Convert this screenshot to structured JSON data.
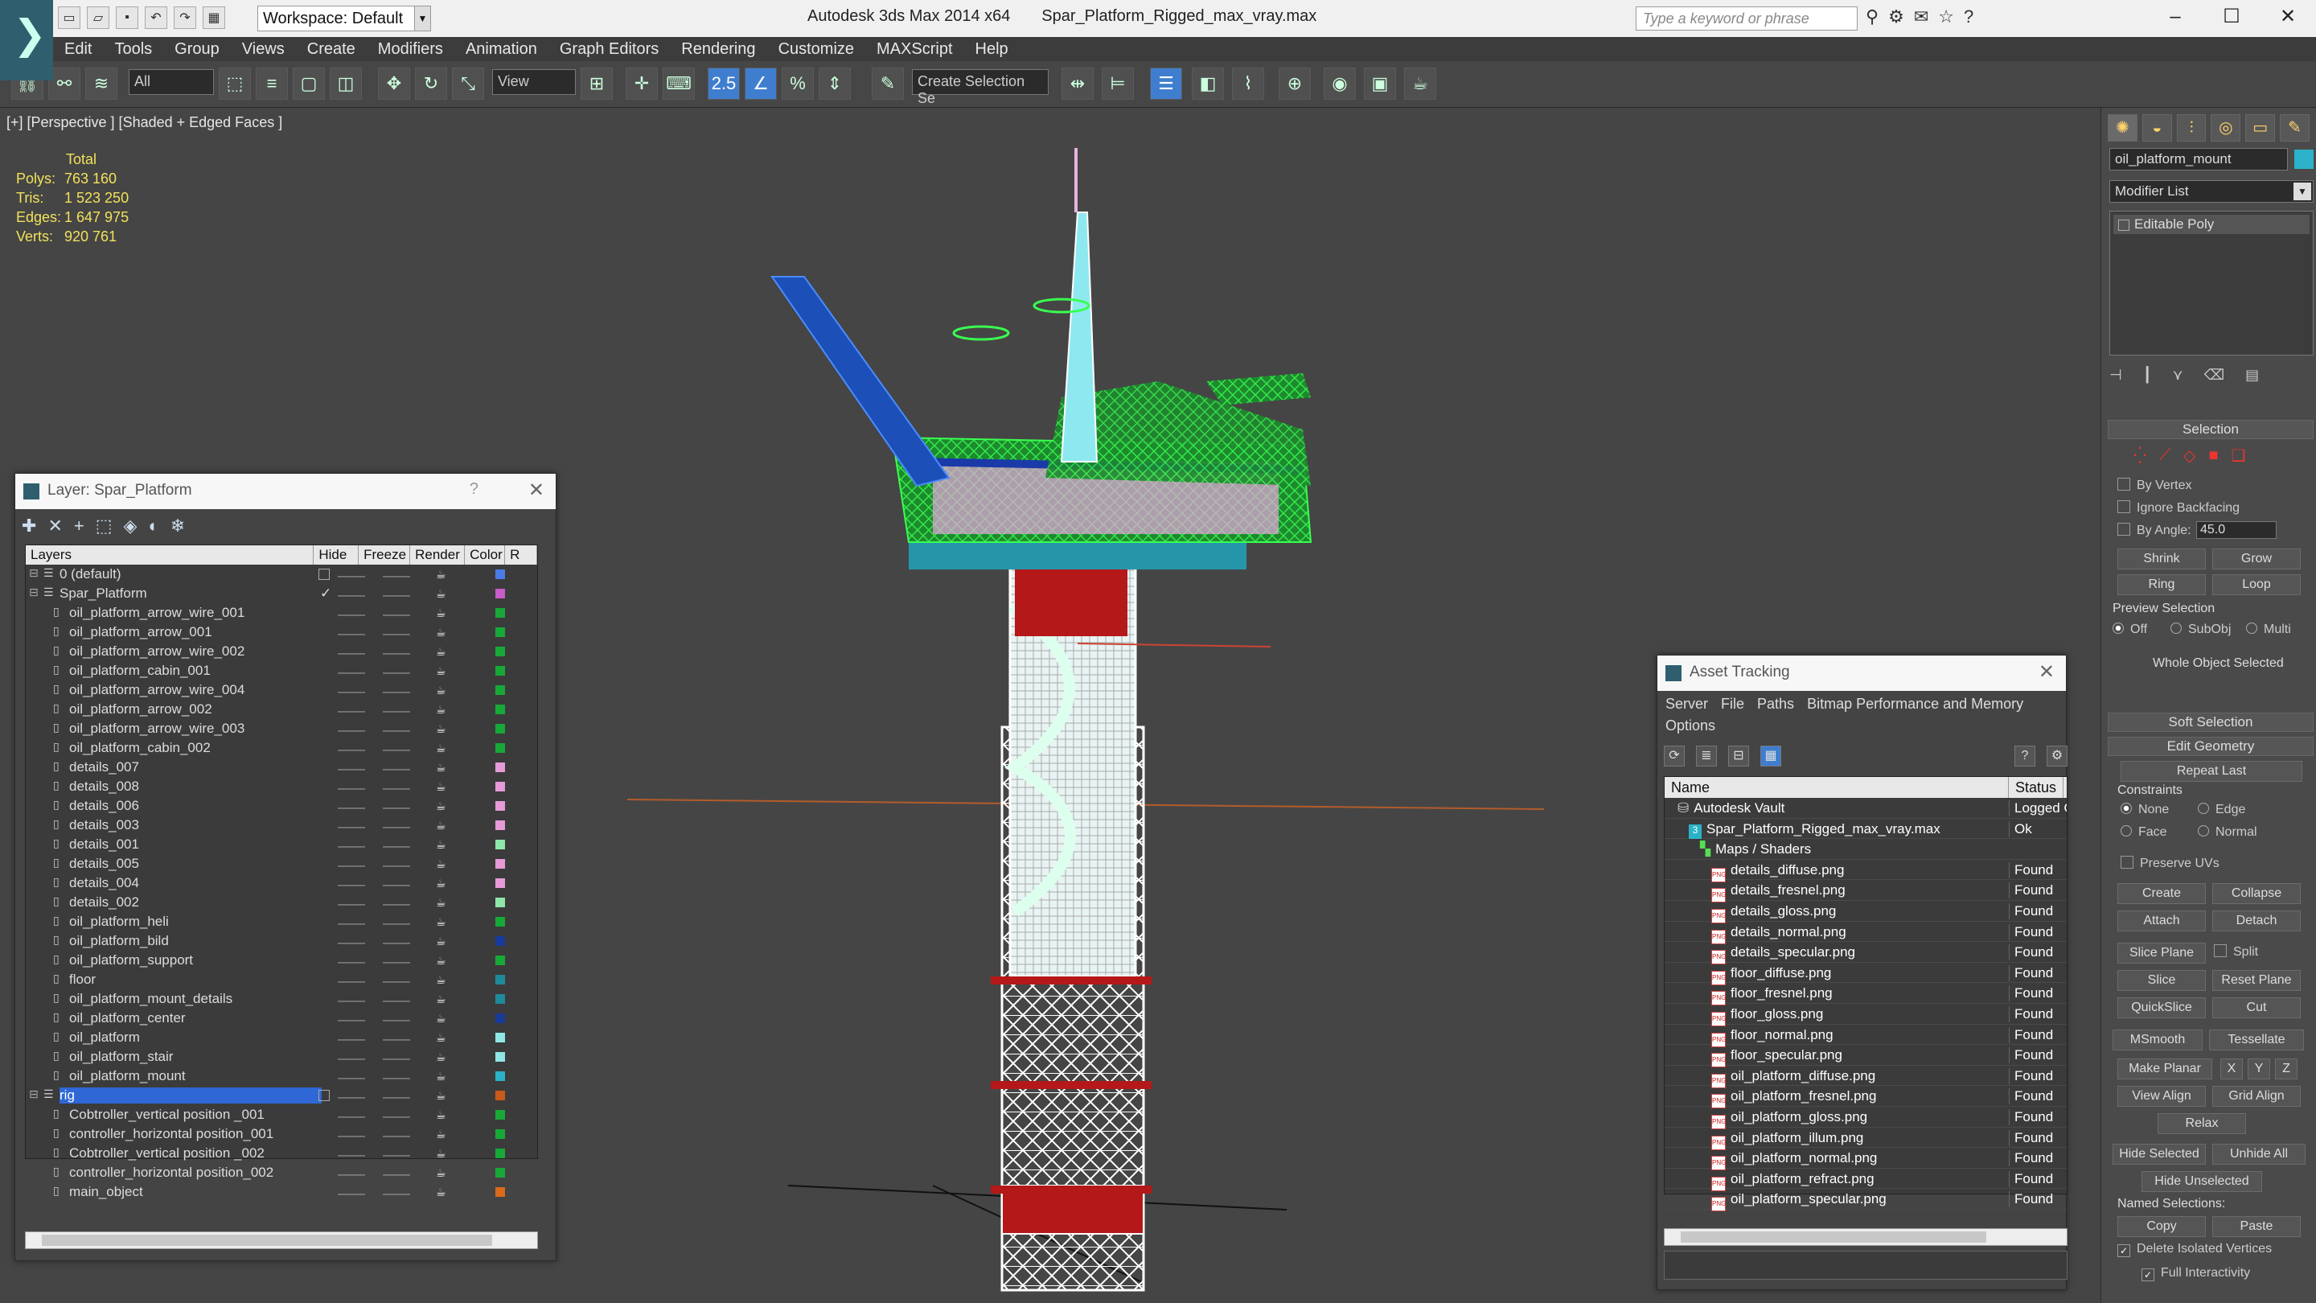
{
  "app": {
    "title": "Autodesk 3ds Max 2014 x64",
    "file": "Spar_Platform_Rigged_max_vray.max",
    "workspace": "Workspace: Default",
    "search_placeholder": "Type a keyword or phrase"
  },
  "menu": [
    "Edit",
    "Tools",
    "Group",
    "Views",
    "Create",
    "Modifiers",
    "Animation",
    "Graph Editors",
    "Rendering",
    "Customize",
    "MAXScript",
    "Help"
  ],
  "toolbar": {
    "filter": "All",
    "view": "View",
    "selection_set": "Create Selection Se",
    "snap": "2.5"
  },
  "viewport": {
    "label": "[+] [Perspective ] [Shaded + Edged Faces ]",
    "stats_header": "Total",
    "stats": [
      {
        "k": "Polys:",
        "v": "763 160"
      },
      {
        "k": "Tris:",
        "v": "1 523 250"
      },
      {
        "k": "Edges:",
        "v": "1 647 975"
      },
      {
        "k": "Verts:",
        "v": "920 761"
      }
    ]
  },
  "layer": {
    "title": "Layer: Spar_Platform",
    "help": "?",
    "cols": [
      "Layers",
      "Hide",
      "Freeze",
      "Render",
      "Color",
      "R"
    ],
    "rows": [
      {
        "name": "0 (default)",
        "ind": 1,
        "color": "#4a7be8",
        "box": true
      },
      {
        "name": "Spar_Platform",
        "ind": 1,
        "color": "#c85cc8",
        "check": true
      },
      {
        "name": "oil_platform_arrow_wire_001",
        "ind": 2,
        "color": "#18a838"
      },
      {
        "name": "oil_platform_arrow_001",
        "ind": 2,
        "color": "#18a838"
      },
      {
        "name": "oil_platform_arrow_wire_002",
        "ind": 2,
        "color": "#18a838"
      },
      {
        "name": "oil_platform_cabin_001",
        "ind": 2,
        "color": "#18a838"
      },
      {
        "name": "oil_platform_arrow_wire_004",
        "ind": 2,
        "color": "#18a838"
      },
      {
        "name": "oil_platform_arrow_002",
        "ind": 2,
        "color": "#18a838"
      },
      {
        "name": "oil_platform_arrow_wire_003",
        "ind": 2,
        "color": "#18a838"
      },
      {
        "name": "oil_platform_cabin_002",
        "ind": 2,
        "color": "#18a838"
      },
      {
        "name": "details_007",
        "ind": 2,
        "color": "#e69ad8"
      },
      {
        "name": "details_008",
        "ind": 2,
        "color": "#e69ad8"
      },
      {
        "name": "details_006",
        "ind": 2,
        "color": "#e69ad8"
      },
      {
        "name": "details_003",
        "ind": 2,
        "color": "#e69ad8"
      },
      {
        "name": "details_001",
        "ind": 2,
        "color": "#8ee6a8"
      },
      {
        "name": "details_005",
        "ind": 2,
        "color": "#e69ad8"
      },
      {
        "name": "details_004",
        "ind": 2,
        "color": "#e69ad8"
      },
      {
        "name": "details_002",
        "ind": 2,
        "color": "#8ee6a8"
      },
      {
        "name": "oil_platform_heli",
        "ind": 2,
        "color": "#18a838"
      },
      {
        "name": "oil_platform_bild",
        "ind": 2,
        "color": "#1a3a9a"
      },
      {
        "name": "oil_platform_support",
        "ind": 2,
        "color": "#18a838"
      },
      {
        "name": "floor",
        "ind": 2,
        "color": "#1f8a9a"
      },
      {
        "name": "oil_platform_mount_details",
        "ind": 2,
        "color": "#1f8a9a"
      },
      {
        "name": "oil_platform_center",
        "ind": 2,
        "color": "#1a3a9a"
      },
      {
        "name": "oil_platform",
        "ind": 2,
        "color": "#8ee6e6"
      },
      {
        "name": "oil_platform_stair",
        "ind": 2,
        "color": "#8ee6e6"
      },
      {
        "name": "oil_platform_mount",
        "ind": 2,
        "color": "#2bb2c8"
      },
      {
        "name": "rig",
        "ind": 1,
        "color": "#c85a1a",
        "box": true,
        "sel": true
      },
      {
        "name": "Cobtroller_vertical position _001",
        "ind": 2,
        "color": "#18a838"
      },
      {
        "name": "controller_horizontal position_001",
        "ind": 2,
        "color": "#18a838"
      },
      {
        "name": "Cobtroller_vertical position _002",
        "ind": 2,
        "color": "#18a838"
      },
      {
        "name": "controller_horizontal position_002",
        "ind": 2,
        "color": "#18a838"
      },
      {
        "name": "main_object",
        "ind": 2,
        "color": "#d86a1a"
      }
    ]
  },
  "asset": {
    "title": "Asset Tracking",
    "menu": [
      "Server",
      "File",
      "Paths",
      "Bitmap Performance and Memory"
    ],
    "menu2": "Options",
    "cols": [
      "Name",
      "Status"
    ],
    "rows": [
      {
        "name": "Autodesk Vault",
        "st": "Logged O",
        "ind": 0,
        "kind": "vault"
      },
      {
        "name": "Spar_Platform_Rigged_max_vray.max",
        "st": "Ok",
        "ind": 1,
        "kind": "max"
      },
      {
        "name": "Maps / Shaders",
        "st": "",
        "ind": 2,
        "kind": "maps"
      },
      {
        "name": "details_diffuse.png",
        "st": "Found",
        "ind": 3,
        "kind": "png"
      },
      {
        "name": "details_fresnel.png",
        "st": "Found",
        "ind": 3,
        "kind": "png"
      },
      {
        "name": "details_gloss.png",
        "st": "Found",
        "ind": 3,
        "kind": "png"
      },
      {
        "name": "details_normal.png",
        "st": "Found",
        "ind": 3,
        "kind": "png"
      },
      {
        "name": "details_specular.png",
        "st": "Found",
        "ind": 3,
        "kind": "png"
      },
      {
        "name": "floor_diffuse.png",
        "st": "Found",
        "ind": 3,
        "kind": "png"
      },
      {
        "name": "floor_fresnel.png",
        "st": "Found",
        "ind": 3,
        "kind": "png"
      },
      {
        "name": "floor_gloss.png",
        "st": "Found",
        "ind": 3,
        "kind": "png"
      },
      {
        "name": "floor_normal.png",
        "st": "Found",
        "ind": 3,
        "kind": "png"
      },
      {
        "name": "floor_specular.png",
        "st": "Found",
        "ind": 3,
        "kind": "png"
      },
      {
        "name": "oil_platform_diffuse.png",
        "st": "Found",
        "ind": 3,
        "kind": "png"
      },
      {
        "name": "oil_platform_fresnel.png",
        "st": "Found",
        "ind": 3,
        "kind": "png"
      },
      {
        "name": "oil_platform_gloss.png",
        "st": "Found",
        "ind": 3,
        "kind": "png"
      },
      {
        "name": "oil_platform_illum.png",
        "st": "Found",
        "ind": 3,
        "kind": "png"
      },
      {
        "name": "oil_platform_normal.png",
        "st": "Found",
        "ind": 3,
        "kind": "png"
      },
      {
        "name": "oil_platform_refract.png",
        "st": "Found",
        "ind": 3,
        "kind": "png"
      },
      {
        "name": "oil_platform_specular.png",
        "st": "Found",
        "ind": 3,
        "kind": "png"
      }
    ]
  },
  "cmd": {
    "object_name": "oil_platform_mount",
    "modifier_list": "Modifier List",
    "stack_item": "Editable Poly",
    "selection": "Selection",
    "by_vertex": "By Vertex",
    "ignore_backfacing": "Ignore Backfacing",
    "by_angle": "By Angle:",
    "angle": "45.0",
    "shrink": "Shrink",
    "grow": "Grow",
    "ring": "Ring",
    "loop": "Loop",
    "preview_selection": "Preview Selection",
    "off": "Off",
    "subobj": "SubObj",
    "multi": "Multi",
    "whole_object": "Whole Object Selected",
    "soft_selection": "Soft Selection",
    "edit_geometry": "Edit Geometry",
    "repeat_last": "Repeat Last",
    "constraints": "Constraints",
    "none": "None",
    "edge": "Edge",
    "face": "Face",
    "normal": "Normal",
    "preserve_uvs": "Preserve UVs",
    "create": "Create",
    "collapse": "Collapse",
    "attach": "Attach",
    "detach": "Detach",
    "slice_plane": "Slice Plane",
    "split": "Split",
    "slice": "Slice",
    "reset_plane": "Reset Plane",
    "quickslice": "QuickSlice",
    "cut": "Cut",
    "msmooth": "MSmooth",
    "tessellate": "Tessellate",
    "make_planar": "Make Planar",
    "x": "X",
    "y": "Y",
    "z": "Z",
    "view_align": "View Align",
    "grid_align": "Grid Align",
    "relax": "Relax",
    "hide_selected": "Hide Selected",
    "unhide_all": "Unhide All",
    "hide_unselected": "Hide Unselected",
    "named_selections": "Named Selections:",
    "copy": "Copy",
    "paste": "Paste",
    "delete_isolated": "Delete Isolated Vertices",
    "full_interactivity": "Full Interactivity"
  }
}
